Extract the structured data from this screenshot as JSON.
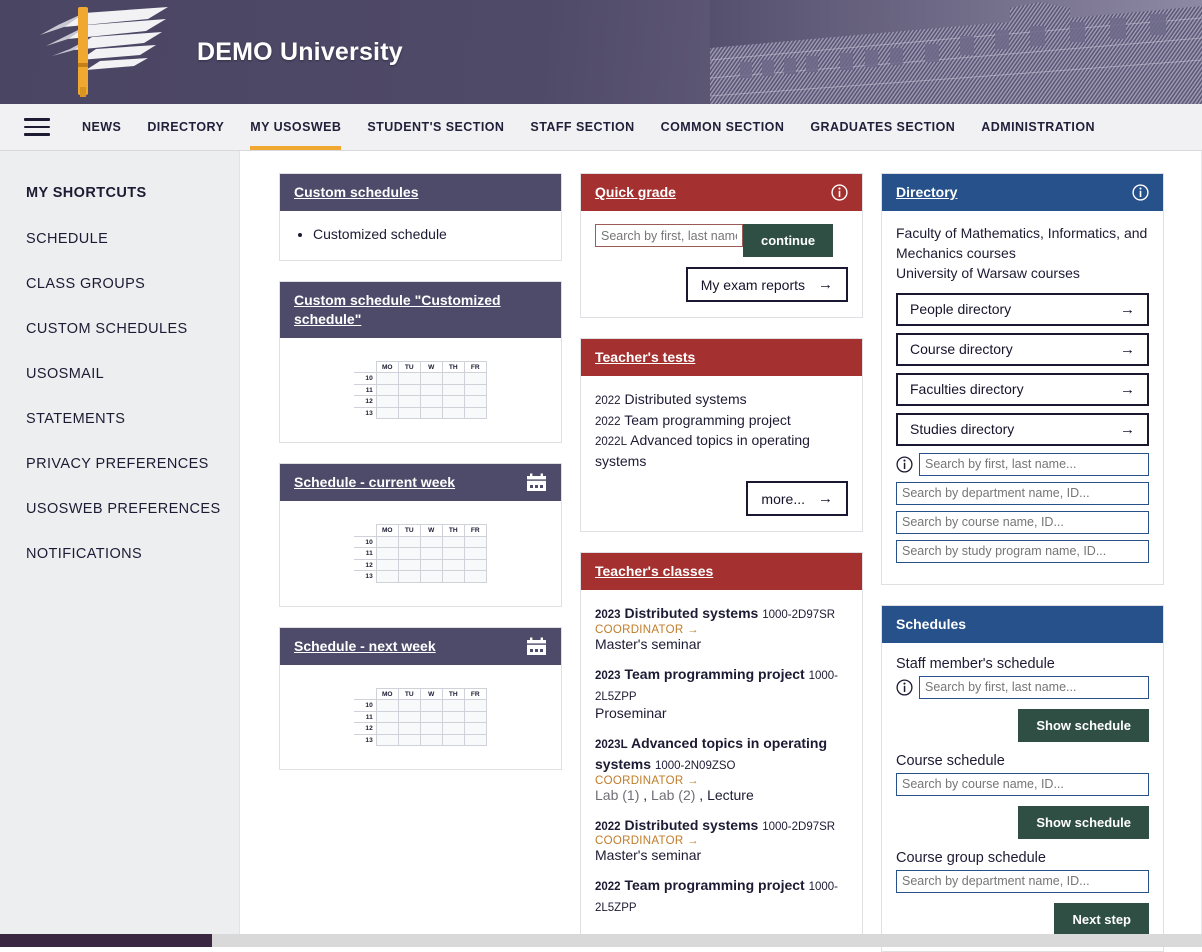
{
  "header": {
    "brand": "DEMO University",
    "logo_icon": "university-logo"
  },
  "nav": {
    "menu_icon": "hamburger-menu-icon",
    "items": [
      {
        "label": "NEWS",
        "active": false
      },
      {
        "label": "DIRECTORY",
        "active": false
      },
      {
        "label": "MY USOSWEB",
        "active": true
      },
      {
        "label": "STUDENT'S SECTION",
        "active": false
      },
      {
        "label": "STAFF SECTION",
        "active": false
      },
      {
        "label": "COMMON SECTION",
        "active": false
      },
      {
        "label": "GRADUATES SECTION",
        "active": false
      },
      {
        "label": "ADMINISTRATION",
        "active": false
      }
    ]
  },
  "sidebar": {
    "title": "MY SHORTCUTS",
    "items": [
      {
        "label": "SCHEDULE"
      },
      {
        "label": "CLASS GROUPS"
      },
      {
        "label": "CUSTOM SCHEDULES"
      },
      {
        "label": "USOSMAIL"
      },
      {
        "label": "STATEMENTS"
      },
      {
        "label": "PRIVACY PREFERENCES"
      },
      {
        "label": "USOSWEB PREFERENCES"
      },
      {
        "label": "NOTIFICATIONS"
      }
    ]
  },
  "schedule_grid": {
    "days": [
      "MO",
      "TU",
      "W",
      "TH",
      "FR"
    ],
    "hours": [
      "10",
      "11",
      "12",
      "13"
    ]
  },
  "cards": {
    "custom_schedules": {
      "title": "Custom schedules",
      "items": [
        "Customized schedule"
      ]
    },
    "custom_schedule_detail": {
      "title": "Custom schedule \"Customized schedule\""
    },
    "schedule_current": {
      "title": "Schedule - current week",
      "icon": "calendar-icon"
    },
    "schedule_next": {
      "title": "Schedule - next week",
      "icon": "calendar-icon"
    },
    "quick_grade": {
      "title": "Quick grade",
      "info_icon": "info-icon",
      "search_placeholder": "Search by first, last name...",
      "search_value": "",
      "continue_label": "continue",
      "exam_reports_label": "My exam reports"
    },
    "teachers_tests": {
      "title": "Teacher's tests",
      "rows": [
        {
          "year": "2022",
          "name": "Distributed systems"
        },
        {
          "year": "2022",
          "name": "Team programming project"
        },
        {
          "year": "2022L",
          "name": "Advanced topics in operating systems"
        }
      ],
      "more_label": "more..."
    },
    "teachers_classes": {
      "title": "Teacher's classes",
      "coordinator_label": "COORDINATOR",
      "rows": [
        {
          "year": "2023",
          "name": "Distributed systems",
          "code": "1000-2D97SR",
          "coordinator": true,
          "groups": [
            {
              "label": "Master's seminar",
              "dim": false
            }
          ]
        },
        {
          "year": "2023",
          "name": "Team programming project",
          "code": "1000-2L5ZPP",
          "coordinator": false,
          "groups": [
            {
              "label": "Proseminar",
              "dim": false
            }
          ]
        },
        {
          "year": "2023L",
          "name": "Advanced topics in operating systems",
          "code": "1000-2N09ZSO",
          "coordinator": true,
          "groups": [
            {
              "label": "Lab (1)",
              "dim": true
            },
            {
              "label": "Lab (2)",
              "dim": true
            },
            {
              "label": "Lecture",
              "dim": false
            }
          ]
        },
        {
          "year": "2022",
          "name": "Distributed systems",
          "code": "1000-2D97SR",
          "coordinator": true,
          "groups": [
            {
              "label": "Master's seminar",
              "dim": false
            }
          ]
        },
        {
          "year": "2022",
          "name": "Team programming project",
          "code": "1000-2L5ZPP",
          "coordinator": false,
          "groups": []
        }
      ]
    },
    "directory": {
      "title": "Directory",
      "info_icon": "info-icon",
      "description_lines": [
        "Faculty of Mathematics, Informatics, and Mechanics courses",
        "University of Warsaw courses"
      ],
      "buttons": [
        {
          "label": "People directory"
        },
        {
          "label": "Course directory"
        },
        {
          "label": "Faculties directory"
        },
        {
          "label": "Studies directory"
        }
      ],
      "searches": [
        {
          "placeholder": "Search by first, last name...",
          "value": "",
          "has_info": true
        },
        {
          "placeholder": "Search by department name, ID...",
          "value": "",
          "has_info": false
        },
        {
          "placeholder": "Search by course name, ID...",
          "value": "",
          "has_info": false
        },
        {
          "placeholder": "Search by study program name, ID...",
          "value": "",
          "has_info": false
        }
      ]
    },
    "schedules": {
      "title": "Schedules",
      "groups": [
        {
          "label": "Staff member's schedule",
          "placeholder": "Search by first, last name...",
          "value": "",
          "has_info": true,
          "button": "Show schedule"
        },
        {
          "label": "Course schedule",
          "placeholder": "Search by course name, ID...",
          "value": "",
          "has_info": false,
          "button": "Show schedule"
        },
        {
          "label": "Course group schedule",
          "placeholder": "Search by department name, ID...",
          "value": "",
          "has_info": false,
          "button": "Next step"
        }
      ]
    }
  },
  "colors": {
    "header_purple": "#4e4a69",
    "card_red": "#a4302f",
    "card_blue": "#27518a",
    "accent_gold": "#f0a830",
    "button_green": "#2f4f45",
    "coordinator_orange": "#c07c27"
  }
}
